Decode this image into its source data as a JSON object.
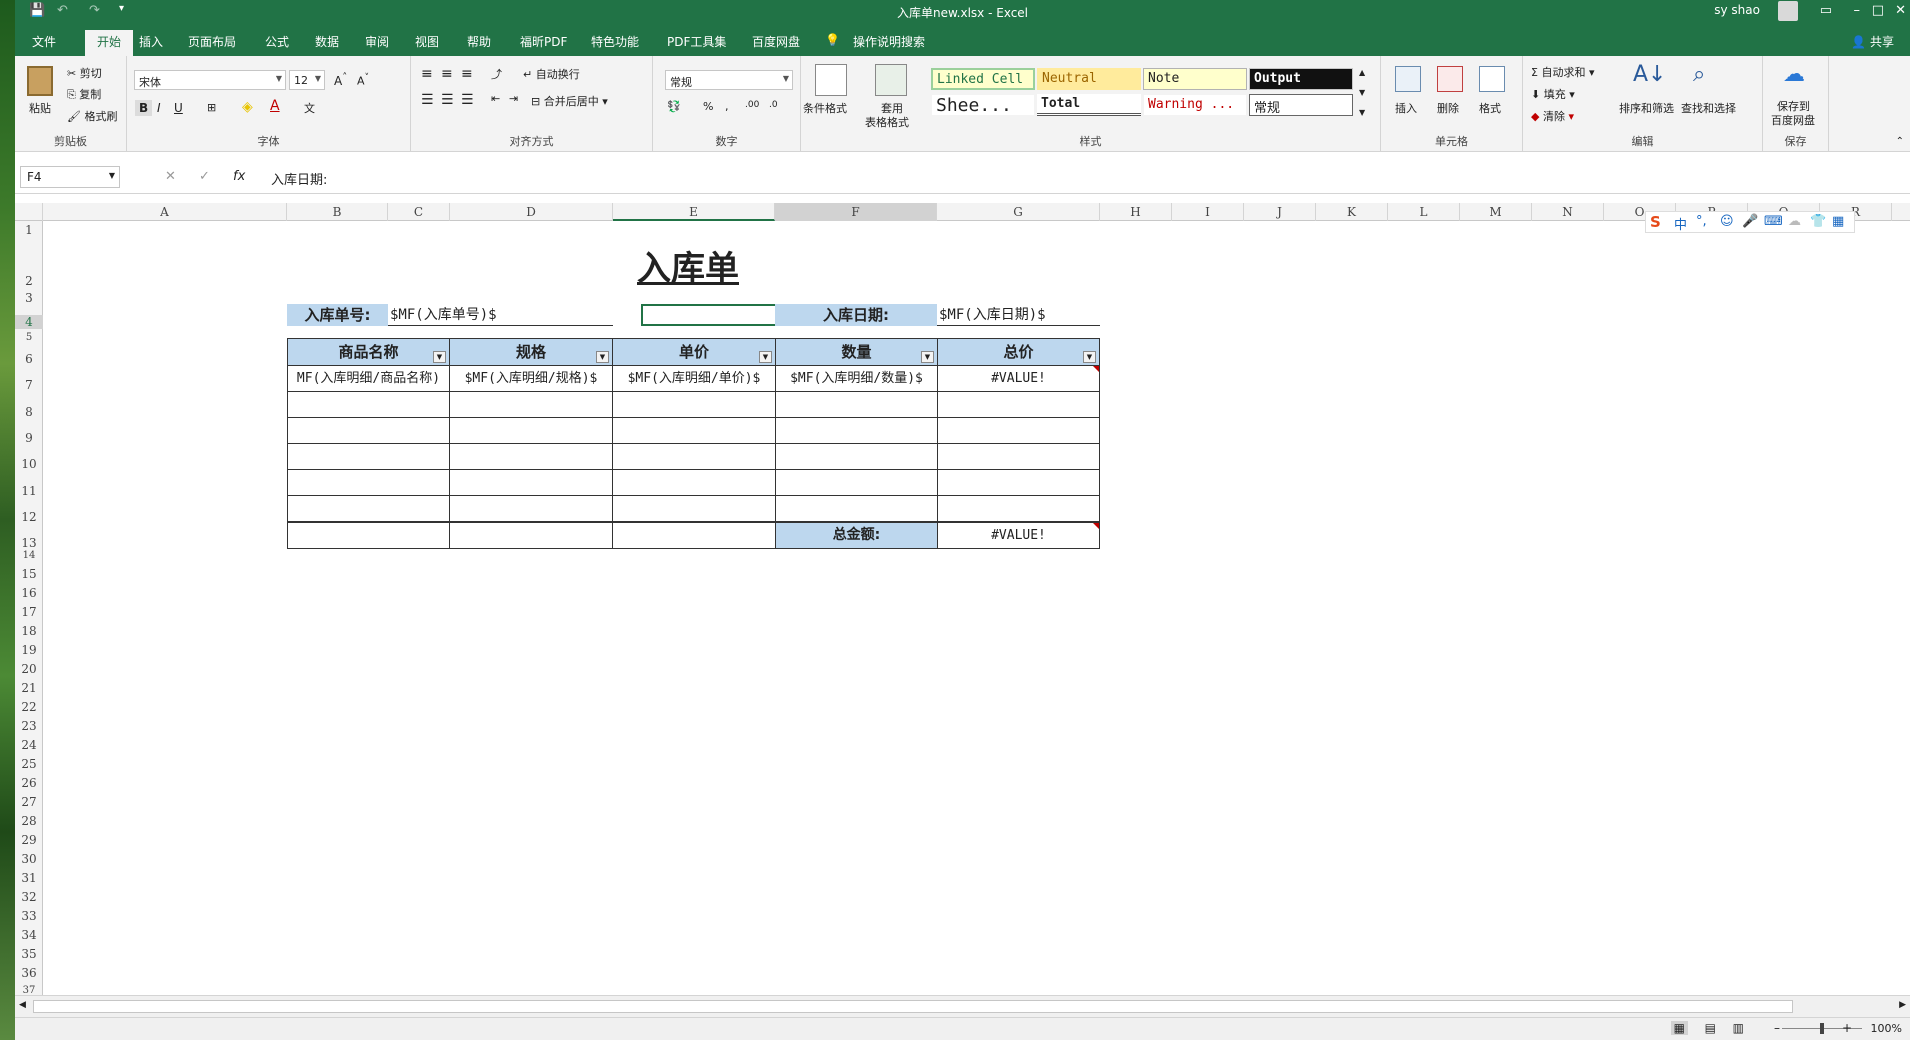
{
  "window": {
    "title": "入库单new.xlsx  -  Excel",
    "user": "sy shao",
    "share": "共享"
  },
  "tabs": [
    "文件",
    "开始",
    "插入",
    "页面布局",
    "公式",
    "数据",
    "审阅",
    "视图",
    "帮助",
    "福昕PDF",
    "特色功能",
    "PDF工具集",
    "百度网盘",
    "操作说明搜索"
  ],
  "ribbon": {
    "clipboard": {
      "label": "剪贴板",
      "paste": "粘贴",
      "cut": "剪切",
      "copy": "复制",
      "painter": "格式刷"
    },
    "font": {
      "label": "字体",
      "name": "宋体",
      "size": "12"
    },
    "align": {
      "label": "对齐方式",
      "wrap": "自动换行",
      "merge": "合并后居中"
    },
    "number": {
      "label": "数字",
      "format": "常规"
    },
    "styles": {
      "label": "样式",
      "cond": "条件格式",
      "table1": "套用",
      "table2": "表格格式",
      "s1": "Linked Cell",
      "s2": "Neutral",
      "s3": "Note",
      "s4": "Output",
      "s5": "Shee...",
      "s6": "Total",
      "s7": "Warning ...",
      "s8": "常规"
    },
    "cells": {
      "label": "单元格",
      "insert": "插入",
      "delete": "删除",
      "format": "格式"
    },
    "editing": {
      "label": "编辑",
      "autosum": "自动求和",
      "fill": "填充",
      "clear": "清除",
      "sort": "排序和筛选",
      "find": "查找和选择"
    },
    "save": {
      "label": "保存",
      "btn1": "保存到",
      "btn2": "百度网盘"
    }
  },
  "formula": {
    "namebox": "F4",
    "content": "入库日期:"
  },
  "columns": [
    "A",
    "B",
    "C",
    "D",
    "E",
    "F",
    "G",
    "H",
    "I",
    "J",
    "K",
    "L",
    "M",
    "N",
    "O",
    "P",
    "Q",
    "R"
  ],
  "rows": [
    "1",
    "2",
    "3",
    "4",
    "5",
    "6",
    "7",
    "8",
    "9",
    "10",
    "11",
    "12",
    "13",
    "14",
    "15",
    "16",
    "17",
    "18",
    "19",
    "20",
    "21",
    "22",
    "23",
    "24",
    "25",
    "26",
    "27",
    "28",
    "29",
    "30",
    "31",
    "32",
    "33",
    "34",
    "35",
    "36",
    "37"
  ],
  "sheet": {
    "title": "入库单",
    "no_label": "入库单号:",
    "no_value": "$MF(入库单号)$",
    "date_label": "入库日期:",
    "date_value": "$MF(入库日期)$",
    "headers": [
      "商品名称",
      "规格",
      "单价",
      "数量",
      "总价"
    ],
    "row7": [
      "MF(入库明细/商品名称)",
      "$MF(入库明细/规格)$",
      "$MF(入库明细/单价)$",
      "$MF(入库明细/数量)$",
      "#VALUE!"
    ],
    "total_label": "总金额:",
    "total_value": "#VALUE!"
  },
  "status": {
    "zoom": "100%"
  },
  "ime": {
    "lang": "中"
  }
}
